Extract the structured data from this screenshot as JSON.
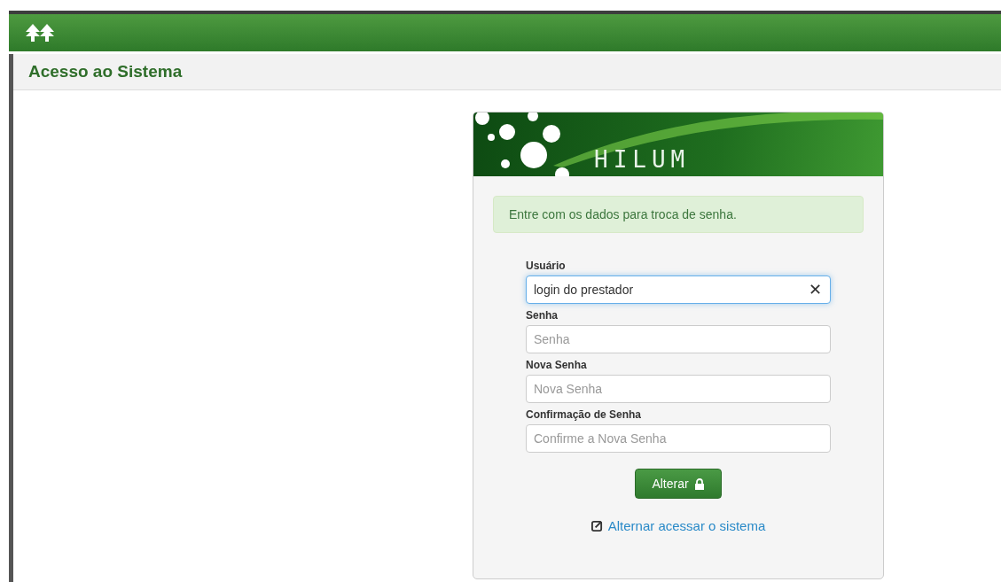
{
  "header": {
    "title": "Acesso ao Sistema"
  },
  "card": {
    "brand": "HILUM",
    "alert": "Entre com os dados para troca de senha.",
    "fields": [
      {
        "label": "Usuário",
        "value": "login do prestador",
        "focused": true,
        "clear": "✕"
      },
      {
        "label": "Senha",
        "placeholder": "Senha",
        "focused": false
      },
      {
        "label": "Nova Senha",
        "placeholder": "Nova Senha",
        "focused": false
      },
      {
        "label": "Confirmação de Senha",
        "placeholder": "Confirme a Nova Senha",
        "focused": false
      }
    ],
    "button": "Alterar",
    "link": "Alternar acessar o sistema"
  }
}
